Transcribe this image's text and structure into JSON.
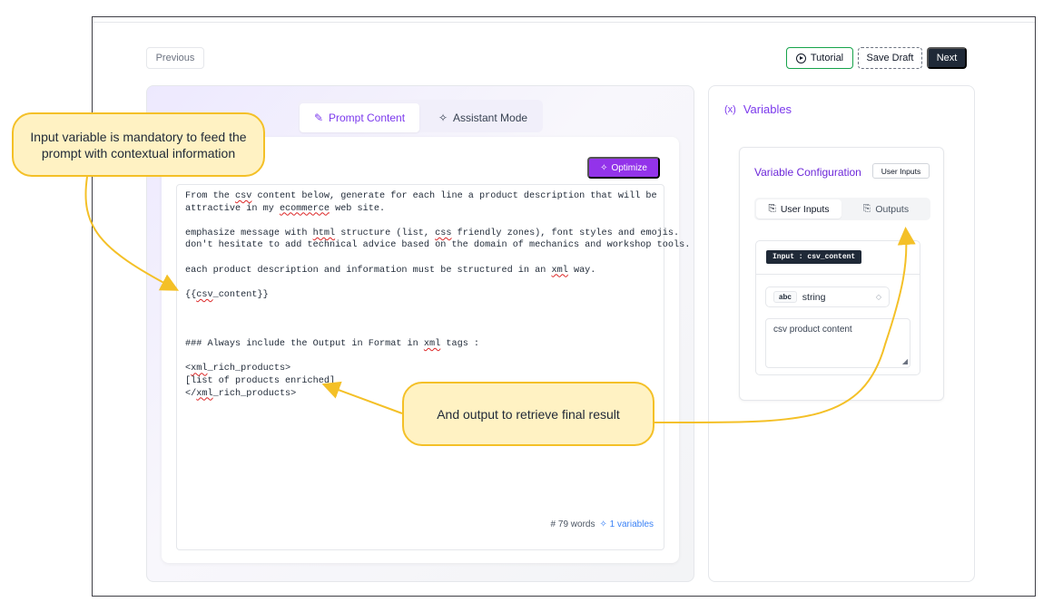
{
  "toolbar": {
    "previous_label": "Previous",
    "tutorial_label": "Tutorial",
    "save_draft_label": "Save Draft",
    "next_label": "Next"
  },
  "tabs": {
    "prompt_content": "Prompt Content",
    "assistant_mode": "Assistant Mode"
  },
  "editor": {
    "optimize_label": "Optimize",
    "word_count": "# 79 words",
    "variables_count": "1 variables"
  },
  "variables": {
    "title": "Variables",
    "config_title": "Variable Configuration",
    "badge": "User Inputs",
    "subtab_inputs": "User Inputs",
    "subtab_outputs": "Outputs",
    "input_tag": "Input : csv_content",
    "type_badge": "abc",
    "type_value": "string",
    "description": "csv product content"
  },
  "annotations": {
    "callout_1": "Input variable is mandatory to feed the prompt with contextual information",
    "callout_2": "And output to retrieve final result"
  },
  "colors": {
    "accent": "#7c3aed",
    "callout_fill": "#fff2c3",
    "callout_border": "#f4c027"
  }
}
